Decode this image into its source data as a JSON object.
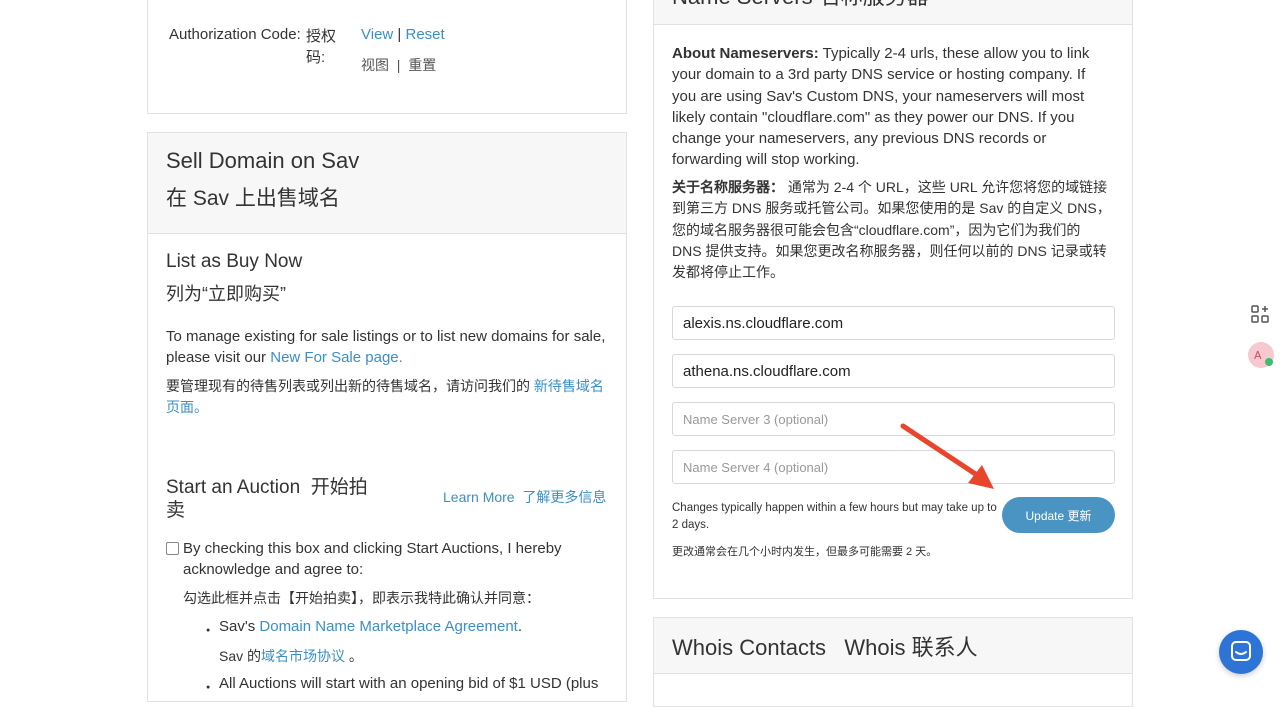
{
  "auth": {
    "label": "Authorization Code:",
    "label_zh": "授权码:",
    "view": "View",
    "separator": "|",
    "reset": "Reset",
    "view_zh": "视图",
    "reset_zh": "重置"
  },
  "sell": {
    "title": "Sell Domain on Sav",
    "title_zh": "在 Sav 上出售域名",
    "list_title": "List as Buy Now",
    "list_title_zh": "列为“立即购买”",
    "manage_text": "To manage existing for sale listings or to list new domains for sale, please visit our",
    "manage_link": "New For Sale page.",
    "manage_text_zh": "要管理现有的待售列表或列出新的待售域名，请访问我们的",
    "manage_link_zh": "新待售域名 页面。",
    "auction_title": "Start an Auction",
    "auction_title_zh": "开始拍卖",
    "learn_more": "Learn More",
    "learn_more_zh": "了解更多信息",
    "checkbox_text": "By checking this box and clicking Start Auctions, I hereby acknowledge and agree to:",
    "checkbox_text_zh": "勾选此框并点击【开始拍卖】，即表示我特此确认并同意：",
    "bullet1_prefix": "Sav's",
    "bullet1_link": "Domain Name Marketplace Agreement",
    "bullet1_suffix": ".",
    "bullet1_zh_prefix": "Sav 的",
    "bullet1_zh_link": "域名市场协议",
    "bullet1_zh_suffix": "。",
    "bullet2": "All Auctions will start with an opening bid of $1 USD (plus"
  },
  "nameservers": {
    "title": "Name Servers 名称服务器",
    "about_label": "About Nameservers:",
    "about_text": "Typically 2-4 urls, these allow you to link your domain to a 3rd party DNS service or hosting company. If you are using Sav's Custom DNS, your nameservers will most likely contain \"cloudflare.com\" as they power our DNS. If you change your nameservers, any previous DNS records or forwarding will stop working.",
    "about_label_zh": "关于名称服务器：",
    "about_text_zh": "通常为 2-4 个 URL，这些 URL 允许您将您的域链接到第三方 DNS 服务或托管公司。如果您使用的是 Sav 的自定义 DNS，您的域名服务器很可能会包含“cloudflare.com”，因为它们为我们的 DNS 提供支持。如果您更改名称服务器，则任何以前的 DNS 记录或转发都将停止工作。",
    "ns1_value": "alexis.ns.cloudflare.com",
    "ns2_value": "athena.ns.cloudflare.com",
    "ns3_placeholder": "Name Server 3 (optional)",
    "ns4_placeholder": "Name Server 4 (optional)",
    "changes_text": "Changes typically happen within a few hours but may take up to 2 days.",
    "changes_text_zh": "更改通常会在几个小时内发生，但最多可能需要 2 天。",
    "update_label": "Update 更新"
  },
  "whois": {
    "title": "Whois Contacts   Whois 联系人"
  },
  "colors": {
    "link": "#3a8fc7",
    "button": "#4a94c4",
    "arrow": "#e8452c",
    "chat": "#2d74d6"
  }
}
